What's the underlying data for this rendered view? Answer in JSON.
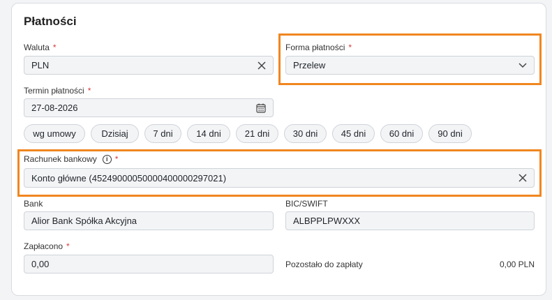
{
  "section": {
    "title": "Płatności"
  },
  "currency": {
    "label": "Waluta",
    "value": "PLN"
  },
  "payment_method": {
    "label": "Forma płatności",
    "value": "Przelew"
  },
  "due_date": {
    "label": "Termin płatności",
    "value": "27-08-2026"
  },
  "quick_terms": [
    "wg umowy",
    "Dzisiaj",
    "7 dni",
    "14 dni",
    "21 dni",
    "30 dni",
    "45 dni",
    "60 dni",
    "90 dni"
  ],
  "bank_account": {
    "label": "Rachunek bankowy",
    "value": "Konto główne (45249000050000400000297021)"
  },
  "bank": {
    "label": "Bank",
    "value": "Alior Bank Spółka Akcyjna"
  },
  "bic": {
    "label": "BIC/SWIFT",
    "value": "ALBPPLPWXXX"
  },
  "paid": {
    "label": "Zapłacono",
    "value": "0,00"
  },
  "remaining": {
    "label": "Pozostało do zapłaty",
    "value": "0,00 PLN"
  },
  "required_mark": "*",
  "colors": {
    "highlight": "#f0861f",
    "required": "#d9383a"
  }
}
